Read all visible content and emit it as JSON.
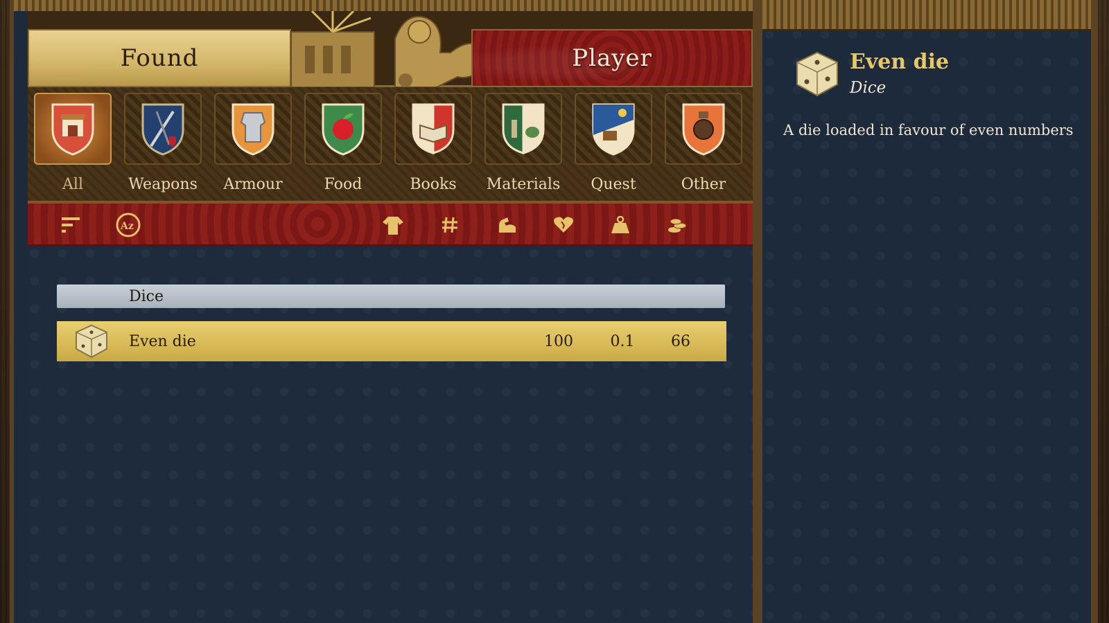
{
  "tabs": {
    "found_label": "Found",
    "player_label": "Player"
  },
  "categories": [
    {
      "label": "All",
      "icon": "shop-shield-icon",
      "active": true
    },
    {
      "label": "Weapons",
      "icon": "weapons-shield-icon",
      "active": false
    },
    {
      "label": "Armour",
      "icon": "armour-shield-icon",
      "active": false
    },
    {
      "label": "Food",
      "icon": "food-shield-icon",
      "active": false
    },
    {
      "label": "Books",
      "icon": "books-shield-icon",
      "active": false
    },
    {
      "label": "Materials",
      "icon": "materials-shield-icon",
      "active": false
    },
    {
      "label": "Quest",
      "icon": "quest-shield-icon",
      "active": false
    },
    {
      "label": "Other",
      "icon": "other-shield-icon",
      "active": false
    }
  ],
  "sort_buttons": [
    {
      "icon": "sort-order-icon",
      "glyph": "☰"
    },
    {
      "icon": "sort-alphabetical-icon",
      "glyph": "Az"
    },
    {
      "icon": "sort-clothing-icon",
      "glyph": "👕"
    },
    {
      "icon": "sort-count-icon",
      "glyph": "#"
    },
    {
      "icon": "sort-strength-icon",
      "glyph": "💪"
    },
    {
      "icon": "sort-condition-icon",
      "glyph": "♥"
    },
    {
      "icon": "sort-weight-icon",
      "glyph": "⚖"
    },
    {
      "icon": "sort-price-icon",
      "glyph": "¤"
    }
  ],
  "list": {
    "group_label": "Dice",
    "items": [
      {
        "name": "Even die",
        "value1": "100",
        "value2": "0.1",
        "value3": "66",
        "icon": "die-icon"
      }
    ]
  },
  "detail": {
    "title": "Even die",
    "subtitle": "Dice",
    "description": "A die loaded in favour of even numbers",
    "icon": "die-icon"
  },
  "colors": {
    "accent_gold": "#e8c766",
    "selected_row": "#d7b955",
    "banner_red": "#8c1d1a",
    "panel_blue": "#1c2a3c"
  }
}
